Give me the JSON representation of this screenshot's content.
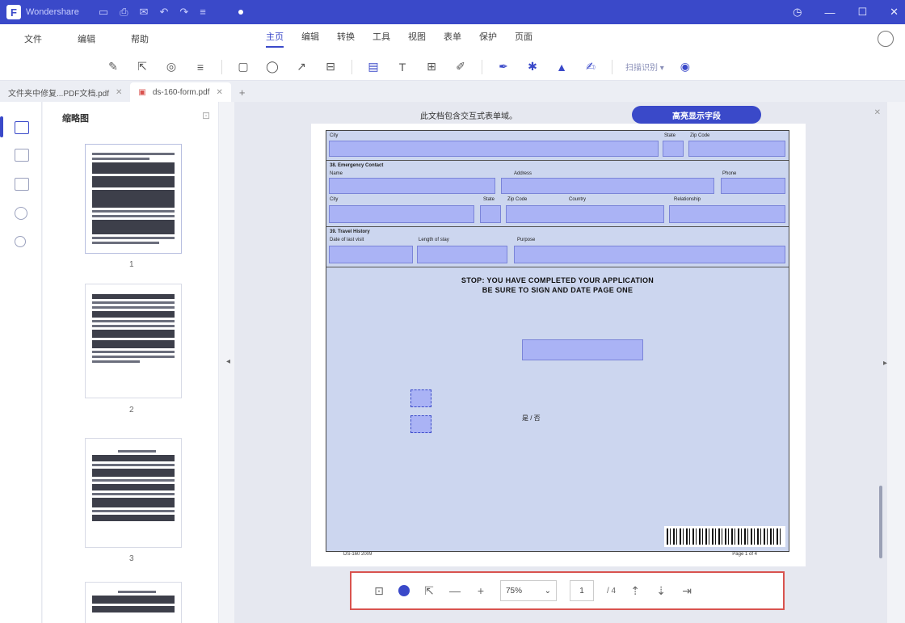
{
  "title_bar": {
    "app_name": "Wondershare",
    "win_minimize": "—",
    "win_maximize": "☐",
    "win_close": "✕"
  },
  "menu": {
    "left": [
      "文件",
      "编辑",
      "帮助"
    ],
    "center": [
      "主页",
      "编辑",
      "转换",
      "工具",
      "视图",
      "表单",
      "保护",
      "页面"
    ],
    "active": "主页"
  },
  "toolbar": {
    "ocr_label": "扫描识别 ▾"
  },
  "tabs": [
    {
      "label": "文件夹中修复...PDF文档.pdf",
      "active": false
    },
    {
      "label": "ds-160-form.pdf",
      "active": true
    }
  ],
  "thumbnails": {
    "title": "缩略图",
    "pages": [
      "1",
      "2",
      "3"
    ]
  },
  "banner": {
    "text": "此文档包含交互式表单域。",
    "button": "高亮显示字段"
  },
  "form": {
    "stop_line1": "STOP: YOU HAVE COMPLETED YOUR APPLICATION",
    "stop_line2": "BE SURE TO SIGN AND DATE PAGE ONE",
    "checkbox_label": "是 / 否",
    "footer_left": "DS-160 2009",
    "footer_right": "Page 1 of 4",
    "colors": {
      "field": "#aab3f5",
      "form_bg": "#ccd6ef"
    }
  },
  "bottom_bar": {
    "zoom": "75%",
    "page_current": "1",
    "page_total": "/ 4"
  }
}
